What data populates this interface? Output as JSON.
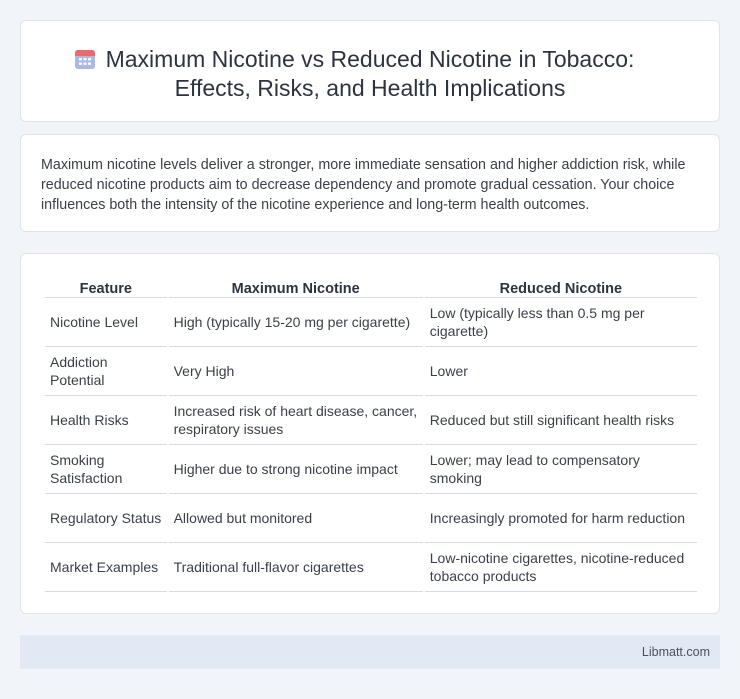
{
  "title": {
    "line1": "Maximum Nicotine vs Reduced Nicotine in Tobacco:",
    "line2": "Effects, Risks, and Health Implications",
    "icon": "calendar-icon"
  },
  "summary": "Maximum nicotine levels deliver a stronger, more immediate sensation and higher addiction risk, while reduced nicotine products aim to decrease dependency and promote gradual cessation. Your choice influences both the intensity of the nicotine experience and long-term health outcomes.",
  "table": {
    "headers": [
      "Feature",
      "Maximum Nicotine",
      "Reduced Nicotine"
    ],
    "rows": [
      [
        "Nicotine Level",
        "High (typically 15-20 mg per cigarette)",
        "Low (typically less than 0.5 mg per cigarette)"
      ],
      [
        "Addiction Potential",
        "Very High",
        "Lower"
      ],
      [
        "Health Risks",
        "Increased risk of heart disease, cancer, respiratory issues",
        "Reduced but still significant health risks"
      ],
      [
        "Smoking Satisfaction",
        "Higher due to strong nicotine impact",
        "Lower; may lead to compensatory smoking"
      ],
      [
        "Regulatory Status",
        "Allowed but monitored",
        "Increasingly promoted for harm reduction"
      ],
      [
        "Market Examples",
        "Traditional full-flavor cigarettes",
        "Low-nicotine cigarettes, nicotine-reduced tobacco products"
      ]
    ]
  },
  "footer": {
    "site": "Libmatt.com"
  },
  "colors": {
    "background": "#f1f4f9",
    "card": "#ffffff",
    "footer": "#e3e9f4",
    "icon_top": "#e96a6a",
    "icon_body": "#8fa4d8"
  }
}
